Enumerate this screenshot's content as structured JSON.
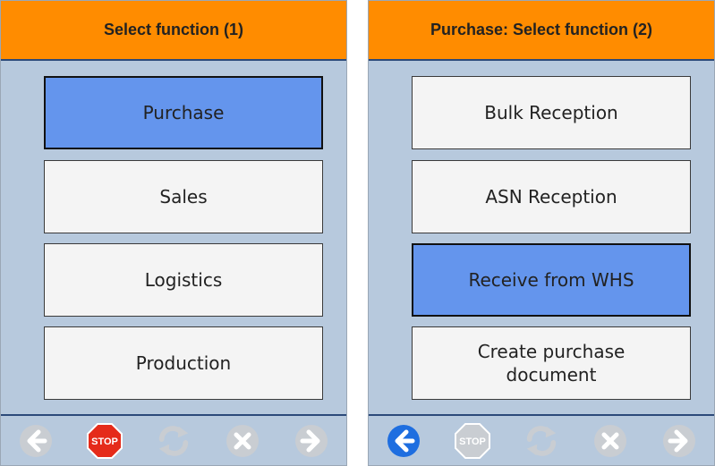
{
  "screen1": {
    "title": "Select function (1)",
    "items": [
      {
        "label": "Purchase",
        "selected": true
      },
      {
        "label": "Sales",
        "selected": false
      },
      {
        "label": "Logistics",
        "selected": false
      },
      {
        "label": "Production",
        "selected": false
      }
    ],
    "toolbar": {
      "stop_label": "STOP"
    }
  },
  "screen2": {
    "title": "Purchase: Select function (2)",
    "items": [
      {
        "label": "Bulk Reception",
        "selected": false
      },
      {
        "label": "ASN Reception",
        "selected": false
      },
      {
        "label": "Receive from WHS",
        "selected": true
      },
      {
        "label": "Create purchase document",
        "selected": false
      }
    ],
    "toolbar": {
      "stop_label": "STOP"
    }
  },
  "colors": {
    "header": "#ff8c00",
    "background": "#b7c9dd",
    "selected": "#6495ed",
    "stop_active": "#e52b1a",
    "back_active": "#1e6ee0",
    "disabled_icon": "#c9cdd2"
  },
  "icons": [
    "back-arrow-icon",
    "stop-icon",
    "refresh-icon",
    "cancel-icon",
    "forward-arrow-icon"
  ]
}
